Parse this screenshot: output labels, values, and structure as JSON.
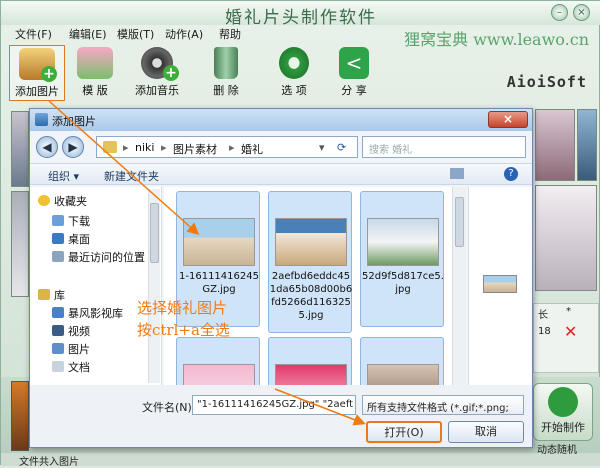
{
  "app": {
    "title": "婚礼片头制作软件",
    "watermark": "狸窝宝典 www.leawo.cn",
    "brand": "AioiSoft",
    "window_buttons": [
      "–",
      "×"
    ],
    "menu": [
      "文件(F)",
      "编辑(E)",
      "模版(T)",
      "动作(A)",
      "帮助"
    ],
    "toolbar": [
      {
        "label": "添加图片",
        "icon": "add-image-icon",
        "active": true
      },
      {
        "label": "模 版",
        "icon": "template-icon"
      },
      {
        "label": "添加音乐",
        "icon": "add-music-icon"
      },
      {
        "label": "删 除",
        "icon": "trash-icon"
      },
      {
        "label": "选 项",
        "icon": "options-gear-icon"
      },
      {
        "label": "分 享",
        "icon": "share-icon"
      }
    ],
    "right_panel": {
      "header_partial": "长",
      "header_star": "*",
      "time_partial": "18",
      "delete_mark": "✕"
    },
    "start_button": "开始制作",
    "effect_label": "动态随机",
    "status_partial": "文件共入图片"
  },
  "dialog": {
    "title": "添加图片",
    "close": "×",
    "path": [
      "niki",
      "图片素材",
      "婚礼"
    ],
    "search_placeholder": "搜索 婚礼",
    "commands": [
      "组织 ▾",
      "新建文件夹"
    ],
    "nav": {
      "favorites": "收藏夹",
      "favorite_items": [
        "下载",
        "桌面",
        "最近访问的位置"
      ],
      "library": "库",
      "library_items": [
        "暴风影视库",
        "视频",
        "图片",
        "文档"
      ]
    },
    "files": [
      {
        "name": "1-16111416245GZ.jpg",
        "selected": true
      },
      {
        "name": "2aefbd6eddc451da65b08d00b6fd5266d1163255.jpg",
        "selected": true
      },
      {
        "name": "52d9f5d817ce5.jpg",
        "selected": true
      },
      {
        "name": "",
        "selected": true
      },
      {
        "name": "",
        "selected": true
      },
      {
        "name": "",
        "selected": true
      }
    ],
    "filename_label": "文件名(N):",
    "filename_value": "\"1-16111416245GZ.jpg\" \"2aeft",
    "filetype": "所有支持文件格式 (*.gif;*.png;",
    "open": "打开(O)",
    "cancel": "取消"
  },
  "annotation": {
    "line1": "选择婚礼图片",
    "line2": "按ctrl+a全选"
  },
  "colors": {
    "accent_orange": "#f07a12",
    "app_green": "#3b6b4b",
    "selection_blue": "#cfe4f8"
  }
}
